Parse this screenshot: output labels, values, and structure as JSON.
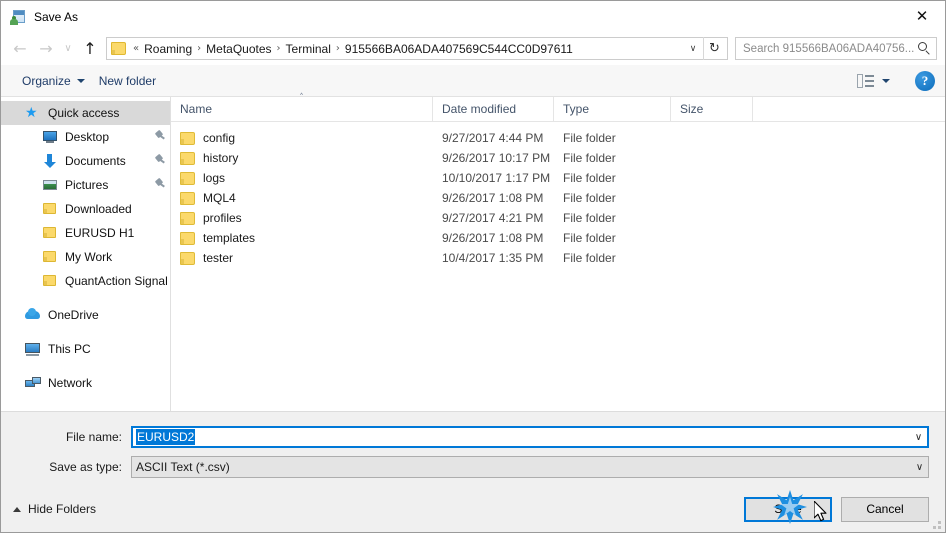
{
  "window": {
    "title": "Save As",
    "title_icon": "save-as-icon",
    "close_label": "✕"
  },
  "nav": {
    "back_icon": "←",
    "forward_icon": "→",
    "recent_icon": "∨",
    "up_icon": "↑",
    "refresh_icon": "↻",
    "dropdown_icon": "∨",
    "breadcrumb_overflow": "«",
    "breadcrumbs": [
      "Roaming",
      "MetaQuotes",
      "Terminal",
      "915566BA06ADA407569C544CC0D97611"
    ],
    "separator": "›"
  },
  "search": {
    "placeholder": "Search 915566BA06ADA40756...",
    "icon": "search-icon"
  },
  "commandbar": {
    "organize": "Organize",
    "new_folder": "New folder",
    "view_icon": "view-layout-icon",
    "view_dropdown_icon": "chevron-down-icon",
    "help": "?"
  },
  "sidebar": {
    "items": [
      {
        "label": "Quick access",
        "icon": "star-icon",
        "level": 0,
        "selected": true,
        "pinned": false
      },
      {
        "label": "Desktop",
        "icon": "monitor-icon",
        "level": 1,
        "selected": false,
        "pinned": true
      },
      {
        "label": "Documents",
        "icon": "download-arrow-icon",
        "level": 1,
        "selected": false,
        "pinned": true
      },
      {
        "label": "Pictures",
        "icon": "picture-icon",
        "level": 1,
        "selected": false,
        "pinned": true
      },
      {
        "label": "Downloaded",
        "icon": "folder-icon",
        "level": 1,
        "selected": false,
        "pinned": false
      },
      {
        "label": "EURUSD H1",
        "icon": "folder-icon",
        "level": 1,
        "selected": false,
        "pinned": false
      },
      {
        "label": "My Work",
        "icon": "folder-icon",
        "level": 1,
        "selected": false,
        "pinned": false
      },
      {
        "label": "QuantAction Signal",
        "icon": "folder-icon",
        "level": 1,
        "selected": false,
        "pinned": false
      },
      {
        "label": "OneDrive",
        "icon": "cloud-icon",
        "level": 0,
        "selected": false,
        "pinned": false
      },
      {
        "label": "This PC",
        "icon": "computer-icon",
        "level": 0,
        "selected": false,
        "pinned": false
      },
      {
        "label": "Network",
        "icon": "network-icon",
        "level": 0,
        "selected": false,
        "pinned": false
      }
    ]
  },
  "filelist": {
    "columns": [
      "Name",
      "Date modified",
      "Type",
      "Size"
    ],
    "sort_indicator": "˄",
    "rows": [
      {
        "name": "config",
        "date": "9/27/2017 4:44 PM",
        "type": "File folder",
        "size": ""
      },
      {
        "name": "history",
        "date": "9/26/2017 10:17 PM",
        "type": "File folder",
        "size": ""
      },
      {
        "name": "logs",
        "date": "10/10/2017 1:17 PM",
        "type": "File folder",
        "size": ""
      },
      {
        "name": "MQL4",
        "date": "9/26/2017 1:08 PM",
        "type": "File folder",
        "size": ""
      },
      {
        "name": "profiles",
        "date": "9/27/2017 4:21 PM",
        "type": "File folder",
        "size": ""
      },
      {
        "name": "templates",
        "date": "9/26/2017 1:08 PM",
        "type": "File folder",
        "size": ""
      },
      {
        "name": "tester",
        "date": "10/4/2017 1:35 PM",
        "type": "File folder",
        "size": ""
      }
    ]
  },
  "form": {
    "filename_label": "File name:",
    "filename_value": "EURUSD2",
    "filetype_label": "Save as type:",
    "filetype_value": "ASCII Text (*.csv)",
    "dropdown_icon": "∨"
  },
  "footer": {
    "hide_folders": "Hide Folders",
    "save": "Save",
    "cancel": "Cancel"
  },
  "colors": {
    "accent": "#0078d7",
    "folder": "#fbd96b",
    "selection": "#0078d7",
    "sidebar_selected": "#d9d9d9"
  }
}
